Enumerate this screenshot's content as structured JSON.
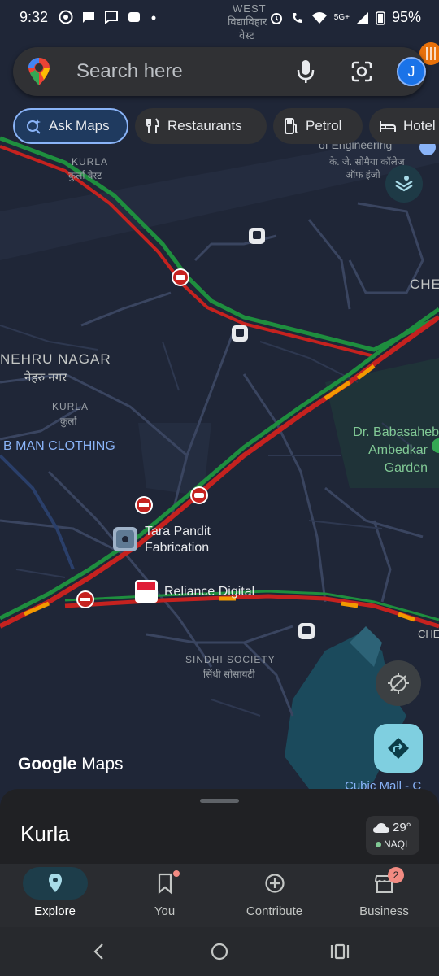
{
  "status_bar": {
    "time": "9:32",
    "network_label": "5G+",
    "battery": "95%",
    "left_icons": [
      "whatsapp-icon",
      "chat-icon",
      "message-icon",
      "app-icon",
      "dot-icon"
    ],
    "right_icons": [
      "alarm-icon",
      "wifi-call-icon",
      "wifi-icon",
      "signal-icon",
      "battery-icon"
    ]
  },
  "search": {
    "placeholder": "Search here",
    "avatar_initial": "J"
  },
  "chips": [
    {
      "label": "Ask Maps",
      "icon": "sparkle-search-icon",
      "active": true
    },
    {
      "label": "Restaurants",
      "icon": "fork-knife-icon",
      "active": false
    },
    {
      "label": "Petrol",
      "icon": "fuel-pump-icon",
      "active": false
    },
    {
      "label": "Hotel",
      "icon": "bed-icon",
      "active": false
    }
  ],
  "map": {
    "labels": {
      "west": "WEST",
      "vidyavihar": "विद्याविहार",
      "west_hi": "वेस्ट",
      "engineering": "of Engineering",
      "engineering_hi1": "के. जे. सोमैया कॉलेज",
      "engineering_hi2": "ऑफ इंजी",
      "kurla_west": "KURLA",
      "kurla_west_hi": "कुर्ला वेस्ट",
      "che_top": "CHE",
      "nehru_nagar": "NEHRU NAGAR",
      "nehru_nagar_hi": "नेहरु नगर",
      "kurla": "KURLA",
      "kurla_hi": "कुर्ला",
      "b_man": "B MAN CLOTHING",
      "ambedkar_1": "Dr. Babasaheb",
      "ambedkar_2": "Ambedkar",
      "ambedkar_3": "Garden",
      "tara_1": "Tara Pandit",
      "tara_2": "Fabrication",
      "reliance": "Reliance Digital",
      "che_bottom": "CHE",
      "sindhi": "SINDHI SOCIETY",
      "sindhi_hi": "सिंधी सोसायटी",
      "cubic": "Cubic Mall - C"
    },
    "attribution_google": "Google",
    "attribution_maps": "Maps",
    "colors": {
      "background": "#1f2637",
      "traffic_heavy": "#c5221f",
      "traffic_moderate": "#f29900",
      "traffic_clear": "#1e8e3e",
      "water": "#1b4a5c",
      "park": "#1f3a33"
    }
  },
  "sheet": {
    "title": "Kurla",
    "weather_temp": "29°",
    "weather_aqi": "NAQI"
  },
  "bottom_nav": [
    {
      "label": "Explore",
      "icon": "location-pin-icon",
      "active": true
    },
    {
      "label": "You",
      "icon": "bookmark-icon",
      "active": false,
      "dot": true
    },
    {
      "label": "Contribute",
      "icon": "add-circle-icon",
      "active": false
    },
    {
      "label": "Business",
      "icon": "storefront-icon",
      "active": false,
      "badge": "2"
    }
  ]
}
